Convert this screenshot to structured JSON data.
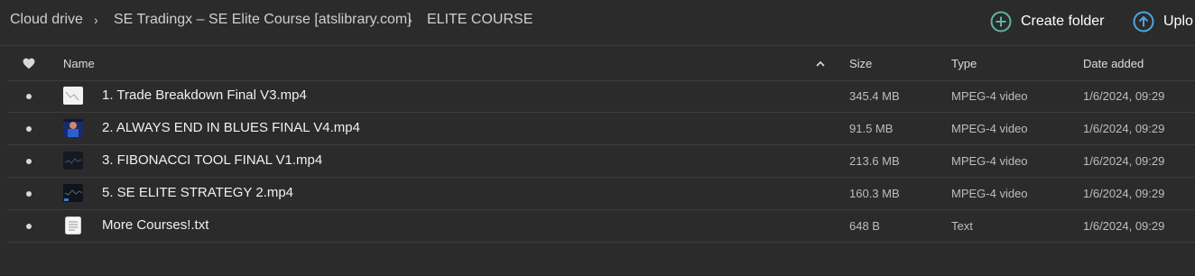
{
  "breadcrumb": {
    "items": [
      "Cloud drive",
      "SE Tradingx – SE Elite Course [atslibrary.com]",
      "ELITE COURSE"
    ],
    "separator": "›"
  },
  "toolbar": {
    "create_folder_label": "Create folder",
    "upload_label": "Uplo"
  },
  "table": {
    "headers": {
      "favorite_icon": "heart-icon",
      "name": "Name",
      "size": "Size",
      "type": "Type",
      "date_added": "Date added"
    },
    "sort": {
      "column": "name",
      "direction": "ascending"
    },
    "rows": [
      {
        "name": "1. Trade Breakdown Final V3.mp4",
        "size": "345.4 MB",
        "type": "MPEG-4 video",
        "date": "1/6/2024, 09:29",
        "thumb": "light-video-thumbnail"
      },
      {
        "name": "2. ALWAYS END IN BLUES FINAL V4.mp4",
        "size": "91.5 MB",
        "type": "MPEG-4 video",
        "date": "1/6/2024, 09:29",
        "thumb": "person-video-thumbnail"
      },
      {
        "name": "3. FIBONACCI TOOL FINAL V1.mp4",
        "size": "213.6 MB",
        "type": "MPEG-4 video",
        "date": "1/6/2024, 09:29",
        "thumb": "dark-chart-thumbnail"
      },
      {
        "name": "5. SE ELITE STRATEGY 2.mp4",
        "size": "160.3 MB",
        "type": "MPEG-4 video",
        "date": "1/6/2024, 09:29",
        "thumb": "dark-chart-thumbnail"
      },
      {
        "name": "More Courses!.txt",
        "size": "648 B",
        "type": "Text",
        "date": "1/6/2024, 09:29",
        "thumb": "text-file-icon"
      }
    ]
  },
  "colors": {
    "background": "#2b2b2b",
    "accent_icon": "#5fb3a3",
    "upload_icon": "#4aa8e0"
  }
}
